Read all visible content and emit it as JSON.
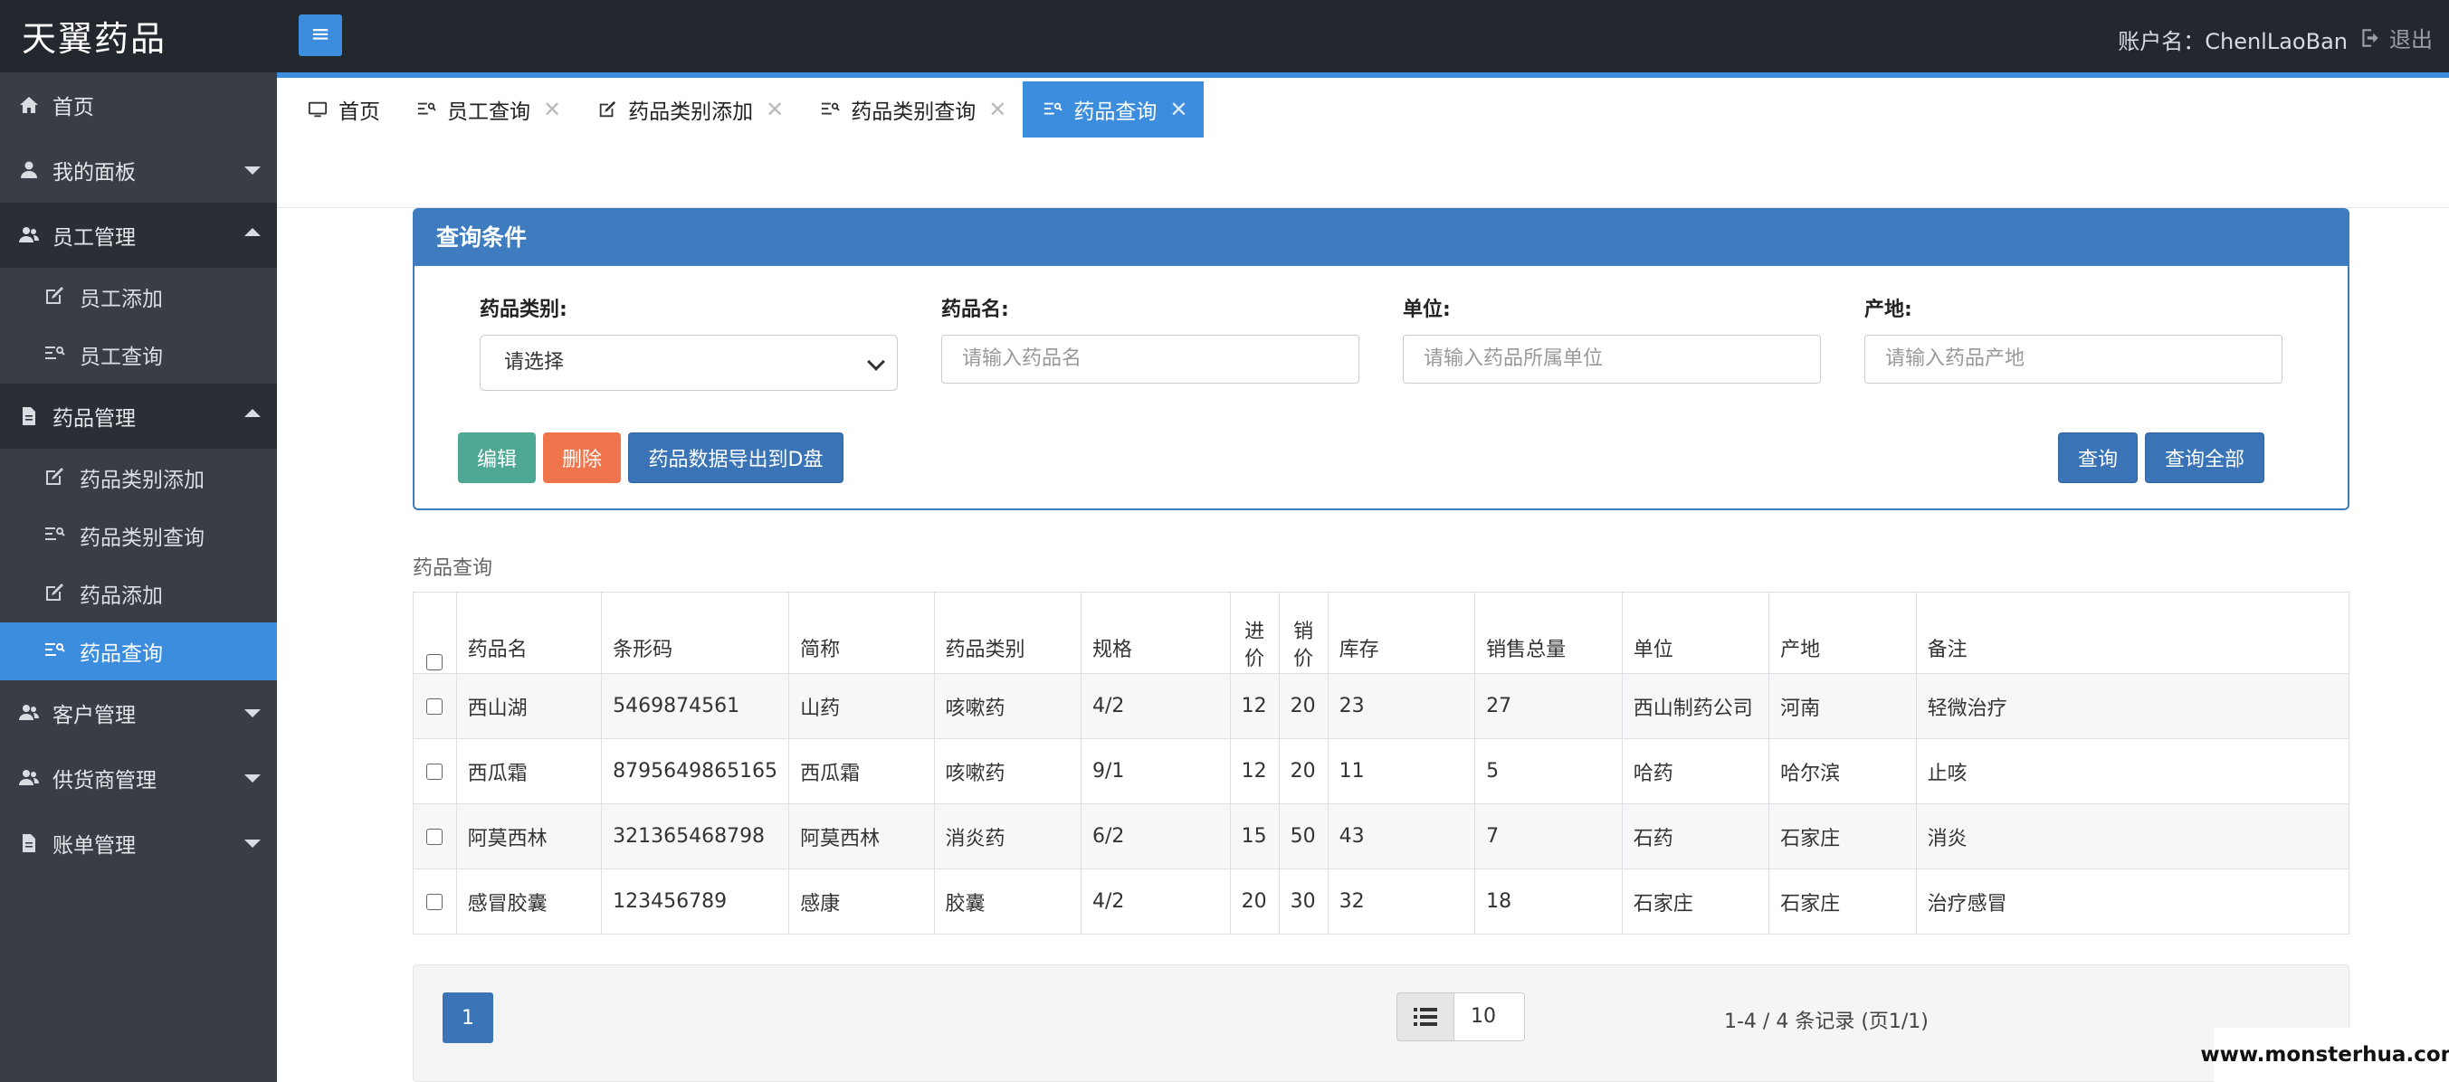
{
  "app": {
    "brand": "天翼药品",
    "account_text": "账户名：ChenlLaoBan",
    "logout_label": "退出"
  },
  "sidebar": {
    "home": "首页",
    "dashboard": "我的面板",
    "staff_group": "员工管理",
    "staff_add": "员工添加",
    "staff_query": "员工查询",
    "drug_group": "药品管理",
    "drug_type_add": "药品类别添加",
    "drug_type_query": "药品类别查询",
    "drug_add": "药品添加",
    "drug_query": "药品查询",
    "customer_group": "客户管理",
    "supplier_group": "供货商管理",
    "bill_group": "账单管理"
  },
  "tabs": [
    {
      "label": "首页"
    },
    {
      "label": "员工查询"
    },
    {
      "label": "药品类别添加"
    },
    {
      "label": "药品类别查询"
    },
    {
      "label": "药品查询"
    }
  ],
  "query": {
    "title": "查询条件",
    "category_label": "药品类别:",
    "category_value": "请选择",
    "name_label": "药品名:",
    "name_placeholder": "请输入药品名",
    "unit_label": "单位:",
    "unit_placeholder": "请输入药品所属单位",
    "origin_label": "产地:",
    "origin_placeholder": "请输入药品产地",
    "edit_btn": "编辑",
    "delete_btn": "删除",
    "export_btn": "药品数据导出到D盘",
    "query_btn": "查询",
    "query_all_btn": "查询全部"
  },
  "table": {
    "caption": "药品查询",
    "headers": {
      "name": "药品名",
      "barcode": "条形码",
      "short": "简称",
      "category": "药品类别",
      "spec": "规格",
      "purchase_a": "进",
      "purchase_b": "价",
      "sale_a": "销",
      "sale_b": "价",
      "stock": "库存",
      "total_sales": "销售总量",
      "unit": "单位",
      "origin": "产地",
      "remark": "备注"
    },
    "rows": [
      {
        "name": "西山湖",
        "barcode": "5469874561",
        "short": "山药",
        "category": "咳嗽药",
        "spec": "4/2",
        "purchase": "12",
        "sale": "20",
        "stock": "23",
        "total_sales": "27",
        "unit": "西山制药公司",
        "origin": "河南",
        "remark": "轻微治疗"
      },
      {
        "name": "西瓜霜",
        "barcode": "8795649865165",
        "short": "西瓜霜",
        "category": "咳嗽药",
        "spec": "9/1",
        "purchase": "12",
        "sale": "20",
        "stock": "11",
        "total_sales": "5",
        "unit": "哈药",
        "origin": "哈尔滨",
        "remark": "止咳"
      },
      {
        "name": "阿莫西林",
        "barcode": "321365468798",
        "short": "阿莫西林",
        "category": "消炎药",
        "spec": "6/2",
        "purchase": "15",
        "sale": "50",
        "stock": "43",
        "total_sales": "7",
        "unit": "石药",
        "origin": "石家庄",
        "remark": "消炎"
      },
      {
        "name": "感冒胶囊",
        "barcode": "123456789",
        "short": "感康",
        "category": "胶囊",
        "spec": "4/2",
        "purchase": "20",
        "sale": "30",
        "stock": "32",
        "total_sales": "18",
        "unit": "石家庄",
        "origin": "石家庄",
        "remark": "治疗感冒"
      }
    ]
  },
  "pager": {
    "current_page": "1",
    "page_size": "10",
    "records_text": "1-4 / 4 条记录 (页1/1)"
  },
  "watermark": "www.monsterhua.com",
  "colors": {
    "primary": "#3c8dde",
    "sidebar_bg": "#393d45",
    "topbar_bg": "#23272e",
    "panel_head": "#3f7cbf",
    "edit": "#4ea893",
    "delete": "#f0754d"
  }
}
